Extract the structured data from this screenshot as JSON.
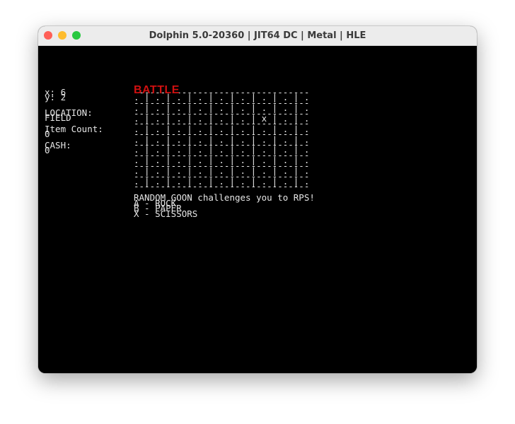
{
  "window": {
    "title": "Dolphin 5.0-20360 | JIT64 DC | Metal | HLE",
    "close_color": "#ff5f57",
    "min_color": "#febc2e",
    "max_color": "#28c840"
  },
  "hud": {
    "x_line": "x: 6",
    "y_line": "y: 2",
    "location_label": "LOCATION:",
    "location_value": "FIELD",
    "item_label": "Item Count:",
    "item_value": "0",
    "cash_label": "CASH:",
    "cash_value": "0"
  },
  "battle_title": "BATTLE",
  "grid": {
    "separator": "---------------------------------",
    "rows": [
      ". | . | . | . | . | . | . | . | .",
      ". | . | . | . | . | . | . | . | .",
      ". | . | . | . | . | . | x | . | .",
      ". | . | . | . | . | . | . | . | .",
      ". | . | . | . | . | . | . | . | .",
      ". | . | . | . | . | . | . | . | .",
      ". | . | . | . | . | . | . | . | .",
      ". | . | . | . | . | . | . | . | .",
      ". | . | . | . | . | . | . | . | ."
    ]
  },
  "dialog": {
    "message": "RANDOM GOON challenges you to RPS!",
    "options": [
      "A - ROCK",
      "B - PAPER",
      "X - SCISSORS"
    ]
  }
}
